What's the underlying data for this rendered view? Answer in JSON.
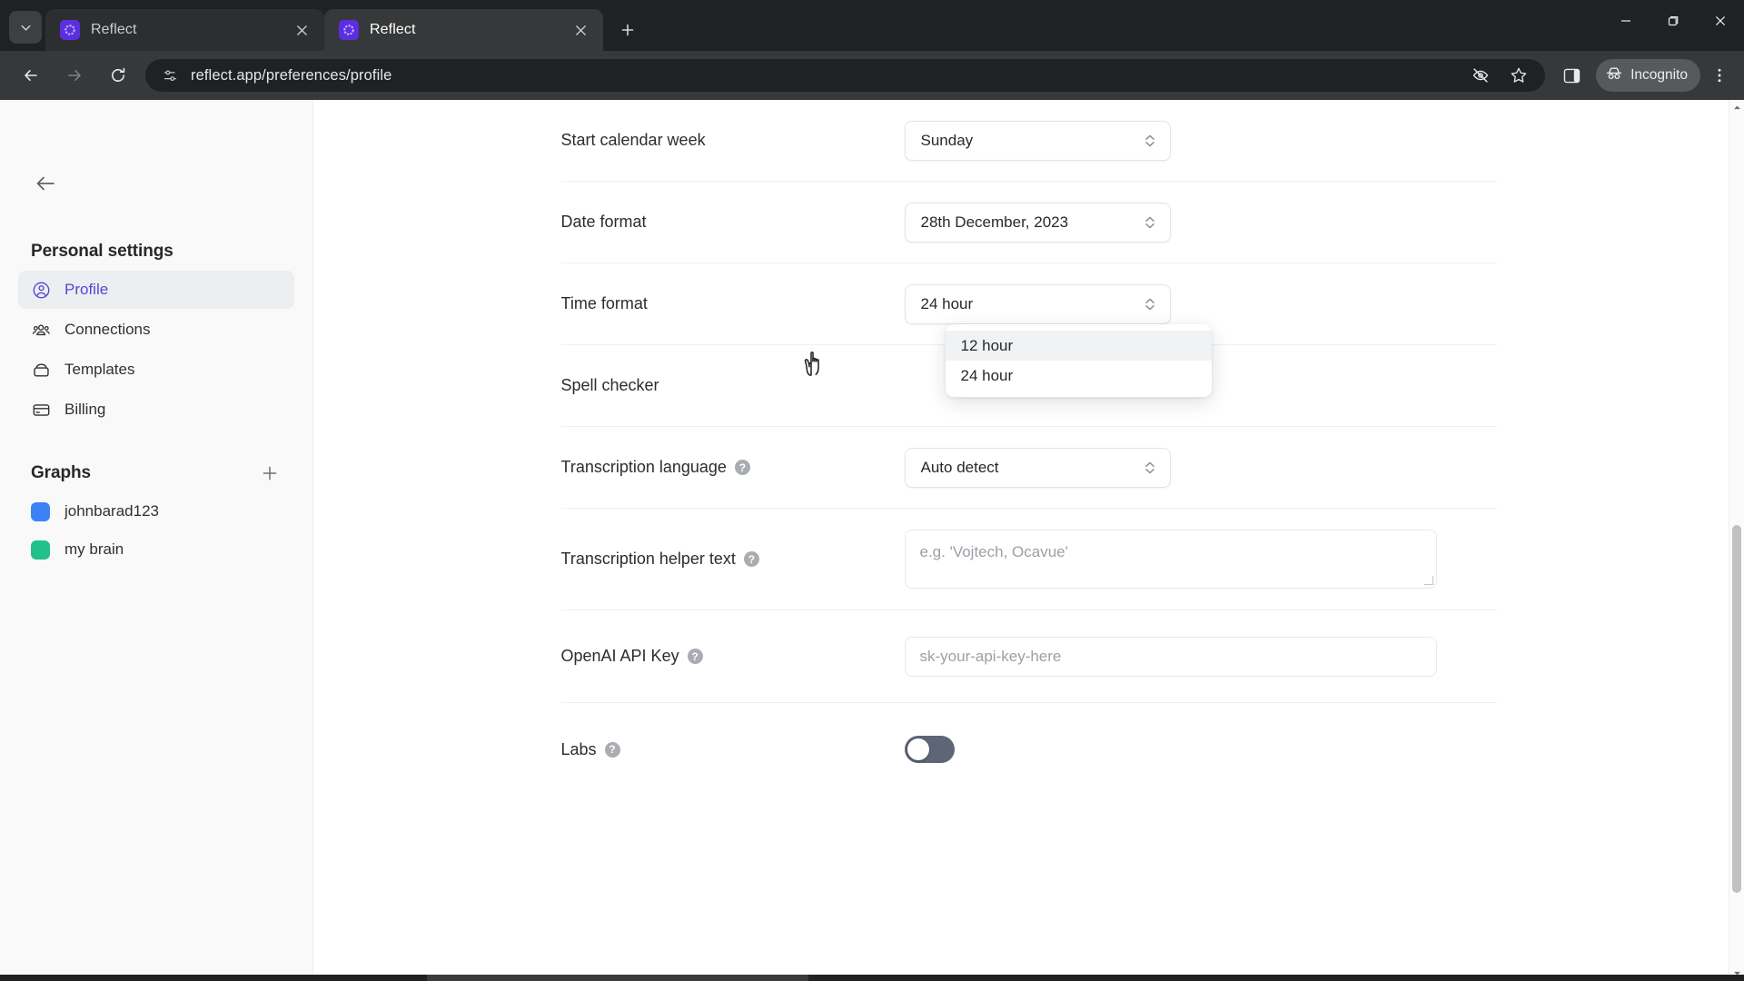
{
  "browser": {
    "tab_search_icon": "chevron-down-icon",
    "tabs": [
      {
        "title": "Reflect",
        "favicon": "reflect-logo-icon",
        "active": false
      },
      {
        "title": "Reflect",
        "favicon": "reflect-logo-icon",
        "active": true
      }
    ],
    "new_tab_label": "+",
    "window_controls": {
      "minimize": "–",
      "maximize": "❐",
      "close": "✕"
    },
    "nav": {
      "back": "back-arrow-icon",
      "forward": "forward-arrow-icon",
      "reload": "reload-icon"
    },
    "omnibox": {
      "url": "reflect.app/preferences/profile",
      "site_icon": "page-settings-icon"
    },
    "toolbar": {
      "hide_password_icon": "eye-off-icon",
      "bookmark_icon": "star-icon",
      "side_panel_icon": "side-panel-icon",
      "incognito_label": "Incognito",
      "incognito_icon": "incognito-hat-icon",
      "menu_icon": "three-dots-vertical-icon"
    }
  },
  "sidebar": {
    "back_icon": "back-arrow-icon",
    "section_title": "Personal settings",
    "items": [
      {
        "label": "Profile",
        "icon": "user-circle-icon",
        "active": true
      },
      {
        "label": "Connections",
        "icon": "people-icon",
        "active": false
      },
      {
        "label": "Templates",
        "icon": "box-icon",
        "active": false
      },
      {
        "label": "Billing",
        "icon": "credit-card-icon",
        "active": false
      }
    ],
    "graphs_title": "Graphs",
    "graphs_add_icon": "plus-icon",
    "graphs": [
      {
        "label": "johnbarad123",
        "color": "#3b82f6"
      },
      {
        "label": "my brain",
        "color": "#22c08a"
      }
    ]
  },
  "settings": {
    "rows": [
      {
        "label": "Start calendar week",
        "help": false,
        "control": "select",
        "value": "Sunday"
      },
      {
        "label": "Date format",
        "help": false,
        "control": "select",
        "value": "28th December, 2023"
      },
      {
        "label": "Time format",
        "help": false,
        "control": "select",
        "value": "24 hour"
      },
      {
        "label": "Spell checker",
        "help": false,
        "control": "none",
        "value": ""
      },
      {
        "label": "Transcription language",
        "help": true,
        "control": "select",
        "value": "Auto detect"
      },
      {
        "label": "Transcription helper text",
        "help": true,
        "control": "textarea",
        "placeholder": "e.g. 'Vojtech, Ocavue'",
        "value": ""
      },
      {
        "label": "OpenAI API Key",
        "help": true,
        "control": "text",
        "placeholder": "sk-your-api-key-here",
        "value": ""
      },
      {
        "label": "Labs",
        "help": true,
        "control": "toggle",
        "value": "off"
      }
    ],
    "help_glyph": "?",
    "time_format_dropdown": {
      "open": true,
      "options": [
        {
          "label": "12 hour",
          "hovered": true
        },
        {
          "label": "24 hour",
          "hovered": false
        }
      ]
    }
  },
  "colors": {
    "accent": "#5a45d6",
    "sidebar_bg": "#f9f9f9",
    "active_item_bg": "#eceef1",
    "toggle_off": "#5d6577",
    "graph_blue": "#3b82f6",
    "graph_green": "#22c08a"
  }
}
